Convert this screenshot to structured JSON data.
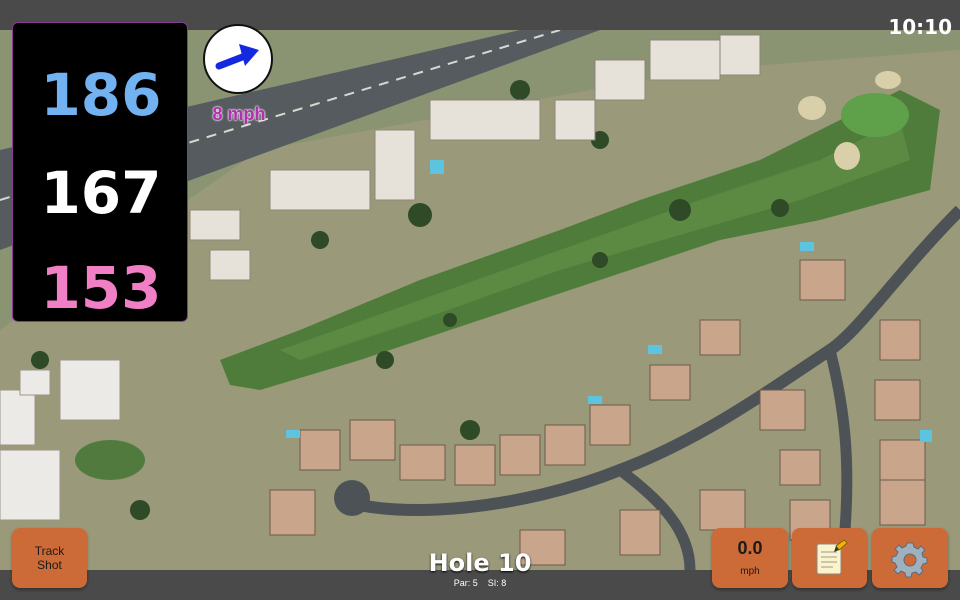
{
  "status": {
    "time": "10:10"
  },
  "distances": {
    "back": "186",
    "middle": "167",
    "front": "153"
  },
  "wind": {
    "speed_label": "8 mph",
    "arrow_color": "#1428e0"
  },
  "buttons": {
    "track_shot_line1": "Track",
    "track_shot_line2": "Shot",
    "speed_value": "0.0",
    "speed_unit": "mph",
    "notes_icon": "notepad-icon",
    "settings_icon": "gear-icon"
  },
  "hole": {
    "title": "Hole 10",
    "par": "Par: 5",
    "si": "SI: 8"
  },
  "colors": {
    "button": "#cc6a38",
    "back": "#72b2f0",
    "front": "#f07fc6",
    "wind_text": "#b32fb0"
  }
}
